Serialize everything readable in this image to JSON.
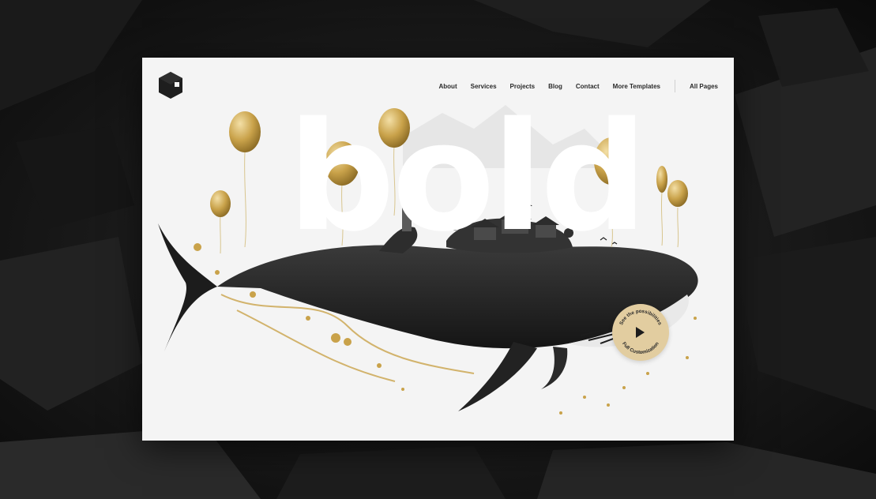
{
  "nav": {
    "items": [
      {
        "label": "About"
      },
      {
        "label": "Services"
      },
      {
        "label": "Projects"
      },
      {
        "label": "Blog"
      },
      {
        "label": "Contact"
      },
      {
        "label": "More Templates"
      }
    ],
    "all_pages": "All Pages"
  },
  "hero": {
    "headline": "bold"
  },
  "badge": {
    "text_top": "See the possibilities",
    "text_bottom": "Full Customization"
  },
  "colors": {
    "accent_gold": "#c9a24a",
    "background": "#f4f4f4",
    "ink": "#1e1e1e"
  },
  "icons": {
    "logo": "cube-logo-icon",
    "play": "play-icon"
  }
}
